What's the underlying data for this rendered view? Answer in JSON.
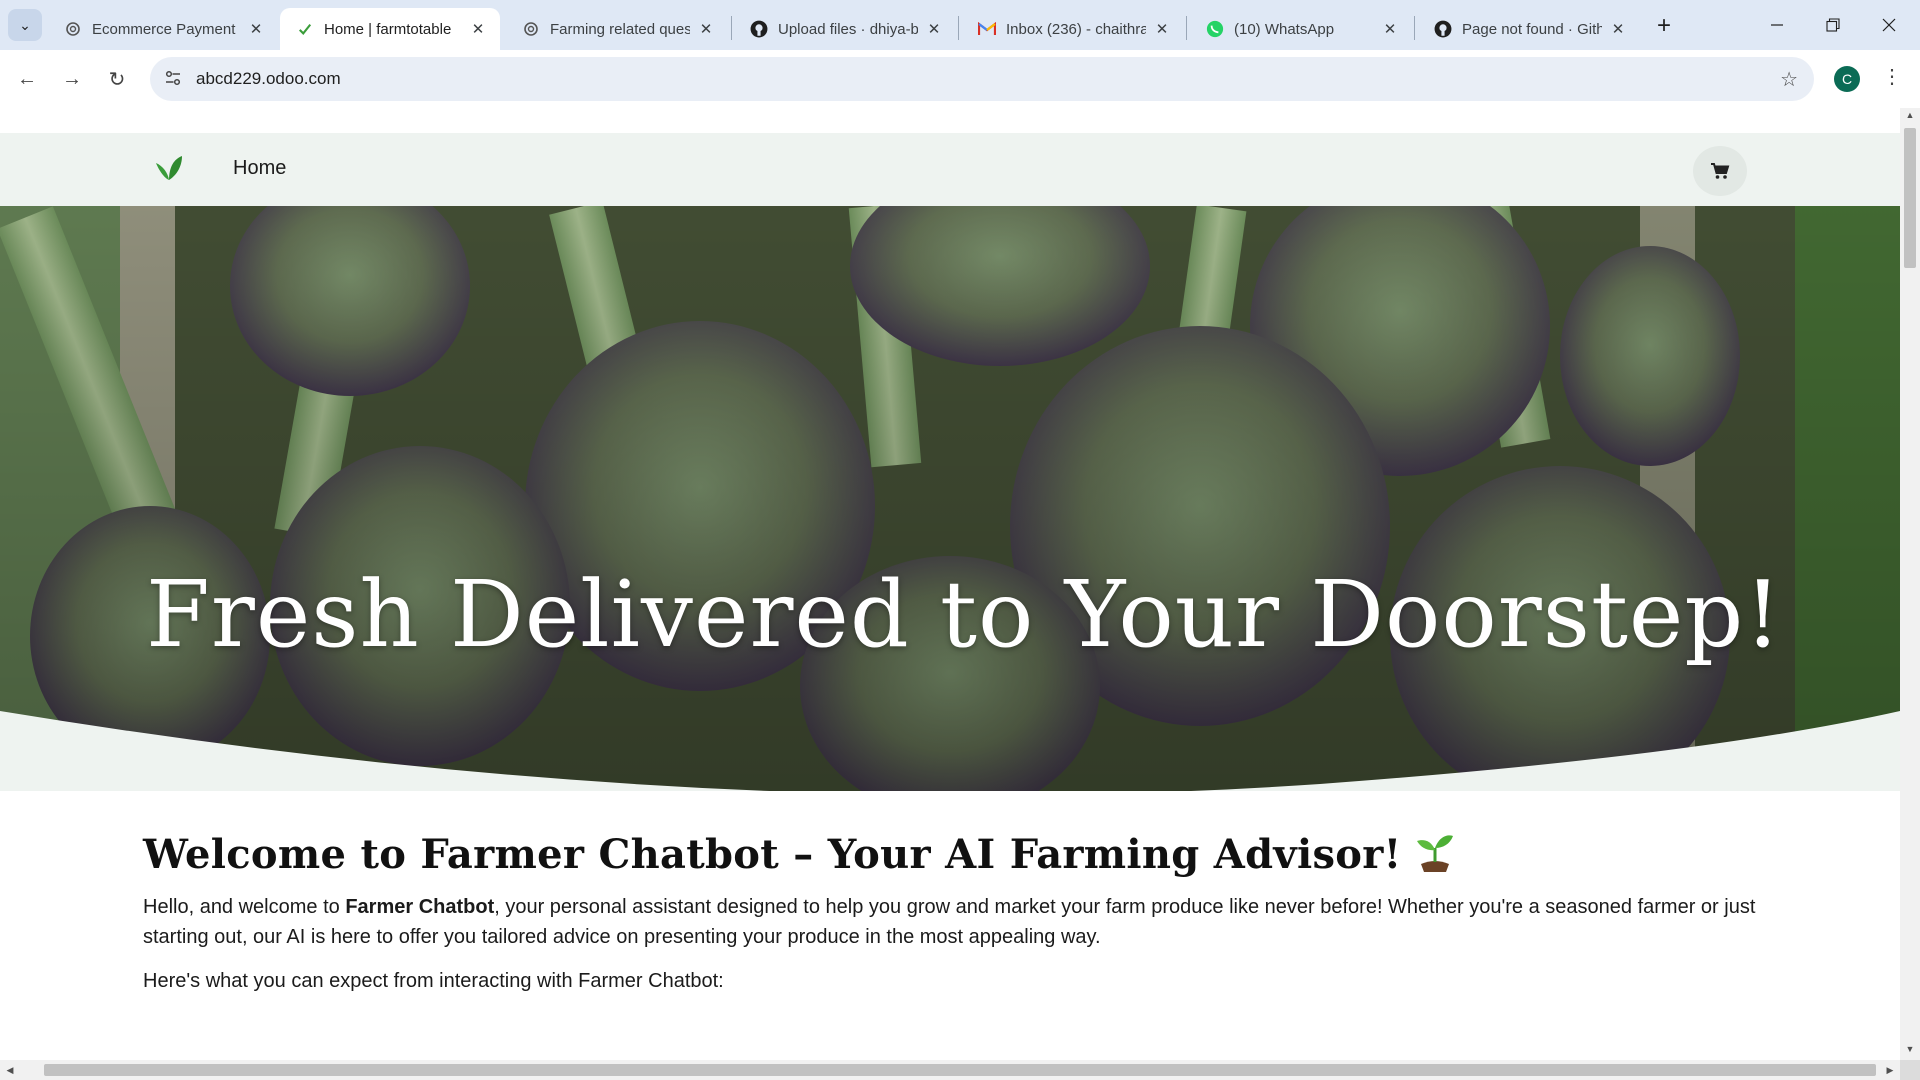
{
  "browser": {
    "tabs": [
      {
        "title": "Ecommerce Payment",
        "icon": "openai-icon",
        "active": false
      },
      {
        "title": "Home | farmtotable",
        "icon": "leaf-icon",
        "active": true
      },
      {
        "title": "Farming related ques",
        "icon": "openai-icon",
        "active": false
      },
      {
        "title": "Upload files · dhiya-b",
        "icon": "github-icon",
        "active": false
      },
      {
        "title": "Inbox (236) - chaithra",
        "icon": "gmail-icon",
        "active": false
      },
      {
        "title": "(10) WhatsApp",
        "icon": "whatsapp-icon",
        "active": false
      },
      {
        "title": "Page not found · Gith",
        "icon": "github-icon",
        "active": false
      }
    ],
    "url": "abcd229.odoo.com",
    "profile_initial": "C"
  },
  "site": {
    "nav_home": "Home",
    "hero_title": "Fresh  Delivered to Your Doorstep!",
    "welcome_title": "Welcome to Farmer Chatbot – Your AI Farming Advisor!",
    "intro_prefix": "Hello, and welcome to ",
    "intro_bold": "Farmer Chatbot",
    "intro_suffix": ", your personal assistant designed to help you grow and market your farm produce like never before! Whether you're a seasoned farmer or just starting out, our AI is here to offer you tailored advice on presenting your produce in the most appealing way.",
    "expect_text": "Here's what you can expect from interacting with Farmer Chatbot:"
  },
  "colors": {
    "brand_green": "#3a9d3a",
    "header_bg": "#eef3f0",
    "tabbar_bg": "#dfe8f5"
  }
}
